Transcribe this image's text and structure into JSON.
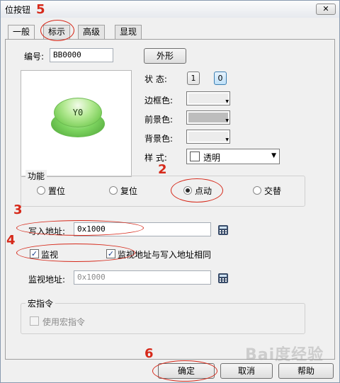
{
  "window": {
    "title": "位按钮",
    "close_symbol": "✕"
  },
  "tabs": [
    {
      "label": "一般",
      "active": true
    },
    {
      "label": "标示",
      "active": false
    },
    {
      "label": "高级",
      "active": false
    },
    {
      "label": "显现",
      "active": false
    }
  ],
  "general": {
    "id_label": "编号:",
    "id_value": "BB0000",
    "appearance_button": "外形",
    "preview_text": "Y0",
    "state_label": "状  态:",
    "state_options": [
      "1",
      "0"
    ],
    "state_selected": "0",
    "border_color_label": "边框色:",
    "foreground_color_label": "前景色:",
    "background_color_label": "背景色:",
    "style_label": "样  式:",
    "style_value": "透明"
  },
  "colors": {
    "border_swatch": "#ececec",
    "foreground_swatch": "#bdbdbd",
    "background_swatch": "#ececec",
    "annotation": "#d6291a"
  },
  "function_group": {
    "title": "功能",
    "options": [
      "置位",
      "复位",
      "点动",
      "交替"
    ],
    "selected": "点动"
  },
  "write_address": {
    "label": "写入地址:",
    "value": "0x1000"
  },
  "monitor": {
    "monitor_label": "监视",
    "same_address_label": "监视地址与写入地址相同",
    "monitor_address_label": "监视地址:",
    "monitor_address_value": "0x1000"
  },
  "macro_group": {
    "title": "宏指令",
    "use_macro_label": "使用宏指令"
  },
  "footer": {
    "ok_label": "确定",
    "cancel_label": "取消",
    "help_label": "帮助"
  },
  "annotations": [
    "5",
    "2",
    "3",
    "4",
    "6"
  ],
  "watermark": "Bai度经验"
}
